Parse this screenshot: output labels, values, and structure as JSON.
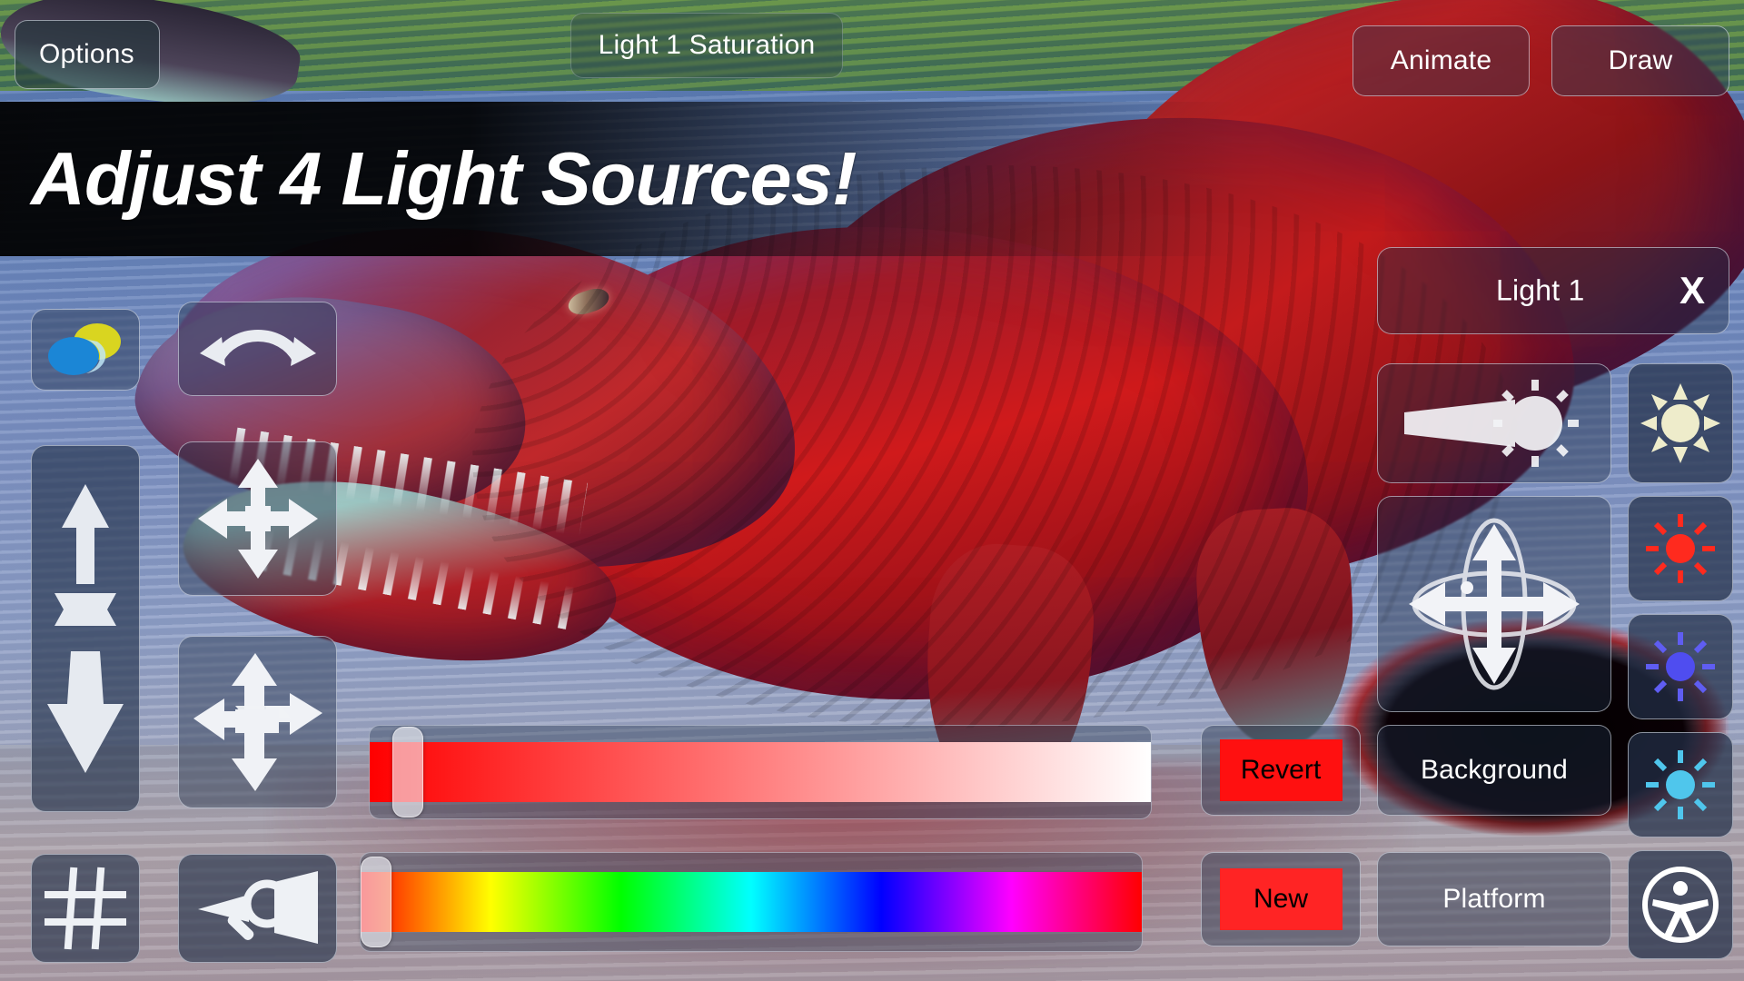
{
  "app": {
    "title": "Light 1 Saturation",
    "promo_banner": "Adjust 4 Light Sources!"
  },
  "header": {
    "options_label": "Options",
    "title_label": "Light 1 Saturation",
    "animate_label": "Animate",
    "draw_label": "Draw"
  },
  "left_toolbar": {
    "items": [
      {
        "name": "color-overlay-icon",
        "tooltip": "Color"
      },
      {
        "name": "rotate-arc-icon",
        "tooltip": "Rotate"
      },
      {
        "name": "scale-vertical-icon",
        "tooltip": "Scale"
      },
      {
        "name": "move-2d-icon",
        "tooltip": "Move"
      },
      {
        "name": "move-3d-icon",
        "tooltip": "Move 3D"
      },
      {
        "name": "grid-icon",
        "tooltip": "Grid"
      },
      {
        "name": "zoom-field-of-view-icon",
        "tooltip": "Zoom"
      }
    ]
  },
  "sliders": {
    "saturation": {
      "name": "Light 1 Saturation",
      "thumb_percent": 3,
      "gradient_from": "#ff0000",
      "gradient_to": "#ffffff"
    },
    "hue": {
      "name": "Light 1 Hue",
      "thumb_percent": 0,
      "spectrum": [
        "#ff0000",
        "#ffff00",
        "#00ff00",
        "#00ffff",
        "#0000ff",
        "#ff00ff",
        "#ff0000"
      ]
    }
  },
  "actions": {
    "revert_label": "Revert",
    "revert_color": "#ff1010",
    "new_label": "New",
    "new_color": "#ff2424",
    "background_label": "Background",
    "platform_label": "Platform"
  },
  "light_panel": {
    "title": "Light 1",
    "close_label": "X",
    "controls": [
      {
        "name": "light-beam-icon",
        "label": "Beam"
      },
      {
        "name": "light-orbit-icon",
        "label": "Orbit"
      }
    ],
    "light_swatches": [
      {
        "name": "sun-light-1-icon",
        "color": "#eeeccb",
        "index": 1
      },
      {
        "name": "sun-light-2-icon",
        "color": "#ff2a1e",
        "index": 2
      },
      {
        "name": "sun-light-3-icon",
        "color": "#4f4df0",
        "index": 3
      },
      {
        "name": "sun-light-4-icon",
        "color": "#4fc6ec",
        "index": 4
      }
    ],
    "accessibility_label": "Accessibility"
  }
}
